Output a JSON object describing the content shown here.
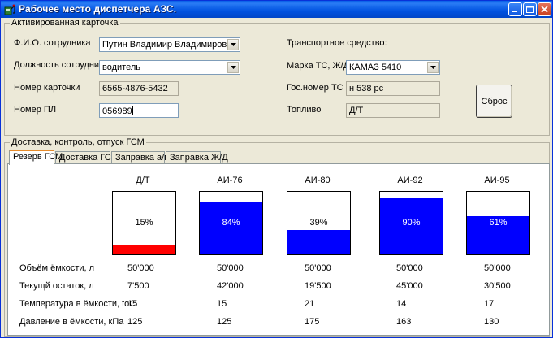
{
  "window": {
    "title": "Рабочее место диспетчера АЗС."
  },
  "card": {
    "legend": "Активированная карточка",
    "employee_label": "Ф.И.О. сотрудника",
    "employee_value": "Путин Владимир Владимирович",
    "position_label": "Должность сотрудника",
    "position_value": "водитель",
    "card_number_label": "Номер карточки",
    "card_number_value": "6565-4876-5432",
    "pl_number_label": "Номер ПЛ",
    "pl_number_value": "056989",
    "vehicle_label": "Транспортное средство:",
    "brand_label": "Марка ТС, Ж/Д",
    "brand_value": "КАМАЗ 5410",
    "plate_label": "Гос.номер ТС",
    "plate_value": "н 538 рс",
    "fuel_label": "Топливо",
    "fuel_value": "Д/Т",
    "reset_label": "Сброс"
  },
  "delivery": {
    "legend": "Доставка, контроль, отпуск ГСМ",
    "tabs": [
      {
        "label": "Резерв ГСМ",
        "active": true
      },
      {
        "label": "Доставка ГСМ",
        "active": false
      },
      {
        "label": "Заправка а/м",
        "active": false
      },
      {
        "label": "Заправка Ж/Д",
        "active": false
      }
    ],
    "row_labels": {
      "volume": "Объём ёмкости, л",
      "remaining": "Текущй остаток, л",
      "temperature": "Температура в ёмкости, toC",
      "pressure": "Давление в ёмкости, кПа"
    },
    "tanks": [
      {
        "name": "Д/Т",
        "level": 15,
        "level_text": "15%",
        "fill_color": "#ff0000",
        "text_color": "#000000",
        "volume": "50'000",
        "remaining": "7'500",
        "temperature": "15",
        "pressure": "125"
      },
      {
        "name": "АИ-76",
        "level": 84,
        "level_text": "84%",
        "fill_color": "#0000ff",
        "text_color": "#ffffff",
        "volume": "50'000",
        "remaining": "42'000",
        "temperature": "15",
        "pressure": "125"
      },
      {
        "name": "АИ-80",
        "level": 39,
        "level_text": "39%",
        "fill_color": "#0000ff",
        "text_color": "#000000",
        "volume": "50'000",
        "remaining": "19'500",
        "temperature": "21",
        "pressure": "175"
      },
      {
        "name": "АИ-92",
        "level": 90,
        "level_text": "90%",
        "fill_color": "#0000ff",
        "text_color": "#ffffff",
        "volume": "50'000",
        "remaining": "45'000",
        "temperature": "14",
        "pressure": "163"
      },
      {
        "name": "АИ-95",
        "level": 61,
        "level_text": "61%",
        "fill_color": "#0000ff",
        "text_color": "#ffffff",
        "volume": "50'000",
        "remaining": "30'500",
        "temperature": "17",
        "pressure": "130"
      }
    ]
  }
}
